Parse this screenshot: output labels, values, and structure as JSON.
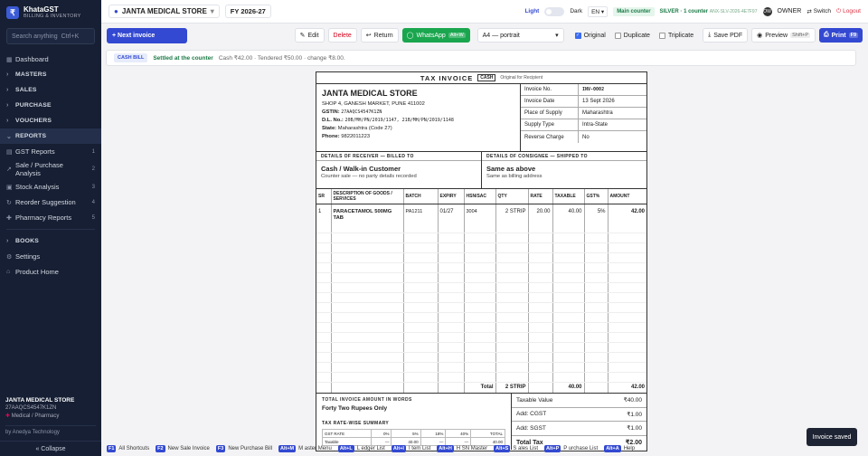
{
  "app": {
    "name": "KhataGST",
    "subtitle": "BILLING & INVENTORY"
  },
  "sidebar": {
    "search_placeholder": "Search anything",
    "search_shortcut": "Ctrl+K",
    "items": [
      {
        "label": "Dashboard"
      },
      {
        "label": "MASTERS"
      },
      {
        "label": "SALES"
      },
      {
        "label": "PURCHASE"
      },
      {
        "label": "VOUCHERS"
      },
      {
        "label": "REPORTS"
      },
      {
        "label": "GST Reports",
        "badge": "1"
      },
      {
        "label": "Sale / Purchase Analysis",
        "badge": "2"
      },
      {
        "label": "Stock Analysis",
        "badge": "3"
      },
      {
        "label": "Reorder Suggestion",
        "badge": "4"
      },
      {
        "label": "Pharmacy Reports",
        "badge": "5"
      },
      {
        "label": "BOOKS"
      },
      {
        "label": "Settings"
      },
      {
        "label": "Product Home"
      }
    ],
    "footer": {
      "shop_name": "JANTA MEDICAL STORE",
      "gstin": "27AAQCS4547K1ZN",
      "type": "Medical / Pharmacy",
      "by": "by Anedya Technology",
      "collapse": "« Collapse"
    }
  },
  "topbar": {
    "store": "JANTA MEDICAL STORE",
    "fy": "FY 2026-27",
    "light": "Light",
    "dark": "Dark",
    "lang": "EN",
    "counter": "Main counter",
    "plan": "SILVER · 1 counter",
    "plan_code": "ANX-SLV-2026-4E7F97",
    "avatar": "OW",
    "role": "OWNER",
    "switch": "Switch",
    "logout": "Logout"
  },
  "toolbar": {
    "next_invoice": "+ Next invoice",
    "edit": "Edit",
    "delete": "Delete",
    "return": "Return",
    "whatsapp": "WhatsApp",
    "whatsapp_key": "Alt+W",
    "paper": "A4 — portrait",
    "original": "Original",
    "duplicate": "Duplicate",
    "triplicate": "Triplicate",
    "save_pdf": "Save PDF",
    "preview": "Preview",
    "preview_key": "Shift+P",
    "print": "Print",
    "print_key": "F9"
  },
  "status": {
    "tag": "CASH BILL",
    "settled": "Settled at the counter",
    "details": "Cash ₹42.00 · Tendered ₹50.00 · change ₹8.00."
  },
  "invoice": {
    "title": "TAX INVOICE",
    "tag": "CASH",
    "copy": "Original for Recipient",
    "seller": {
      "name": "JANTA MEDICAL STORE",
      "address": "SHOP 4, GANESH MARKET, PUNE 411002",
      "gstin_label": "GSTIN:",
      "gstin": "27AAQCS4547K1ZN",
      "dl_label": "D.L. No.:",
      "dl": "20B/MH/PN/2019/1147, 21B/MH/PN/2019/1148",
      "state_label": "State:",
      "state": "Maharashtra (Code 27)",
      "phone_label": "Phone:",
      "phone": "9822011223"
    },
    "meta": [
      {
        "k": "Invoice No.",
        "v": "INV-0002"
      },
      {
        "k": "Invoice Date",
        "v": "13 Sept 2026"
      },
      {
        "k": "Place of Supply",
        "v": "Maharashtra"
      },
      {
        "k": "Supply Type",
        "v": "Intra-State"
      },
      {
        "k": "Reverse Charge",
        "v": "No"
      }
    ],
    "receiver": {
      "head": "DETAILS OF RECEIVER — BILLED TO",
      "name": "Cash / Walk-in Customer",
      "sub": "Counter sale — no party details recorded"
    },
    "consignee": {
      "head": "DETAILS OF CONSIGNEE — SHIPPED TO",
      "name": "Same as above",
      "sub": "Same as billing address"
    },
    "columns": [
      "SR",
      "DESCRIPTION OF GOODS / SERVICES",
      "BATCH",
      "EXPIRY",
      "HSN/SAC",
      "QTY",
      "RATE",
      "TAXABLE",
      "GST%",
      "AMOUNT"
    ],
    "items": [
      {
        "sr": "1",
        "desc": "PARACETAMOL 500MG TAB",
        "batch": "PA1211",
        "expiry": "01/27",
        "hsn": "3004",
        "qty": "2 STRIP",
        "rate": "20.00",
        "taxable": "40.00",
        "gst": "5%",
        "amount": "42.00"
      }
    ],
    "totals": {
      "label": "Total",
      "qty": "2 STRIP",
      "taxable": "40.00",
      "amount": "42.00"
    },
    "words_head": "TOTAL INVOICE AMOUNT IN WORDS",
    "words": "Forty Two Rupees Only",
    "rate_head": "TAX RATE-WISE SUMMARY",
    "rate_cols": [
      "GST RATE",
      "0%",
      "5%",
      "18%",
      "40%",
      "TOTAL"
    ],
    "rate_row": [
      "Taxable",
      "—",
      "40.00",
      "—",
      "—",
      "40.00"
    ],
    "summary": [
      {
        "k": "Taxable Value",
        "v": "₹40.00"
      },
      {
        "k": "Add: CGST",
        "v": "₹1.00"
      },
      {
        "k": "Add: SGST",
        "v": "₹1.00"
      },
      {
        "k": "Total Tax",
        "v": "₹2.00"
      }
    ]
  },
  "shortcuts": [
    {
      "key": "F1",
      "label": "All Shortcuts"
    },
    {
      "key": "F2",
      "label": "New Sale Invoice"
    },
    {
      "key": "F3",
      "label": "New Purchase Bill"
    },
    {
      "key": "Alt+M",
      "label": "M aster Menu"
    },
    {
      "key": "Alt+L",
      "label": "L edger List"
    },
    {
      "key": "Alt+I",
      "label": "I tem List"
    },
    {
      "key": "Alt+H",
      "label": "H SN Master"
    },
    {
      "key": "Alt+S",
      "label": "S ales List"
    },
    {
      "key": "Alt+P",
      "label": "P urchase List"
    },
    {
      "key": "Alt+A",
      "label": "Help"
    }
  ],
  "toast": "Invoice saved",
  "colors": {
    "sidebar": "#161f33",
    "accent": "#3349d1",
    "whatsapp": "#1aa64e",
    "danger": "#d0021b"
  }
}
